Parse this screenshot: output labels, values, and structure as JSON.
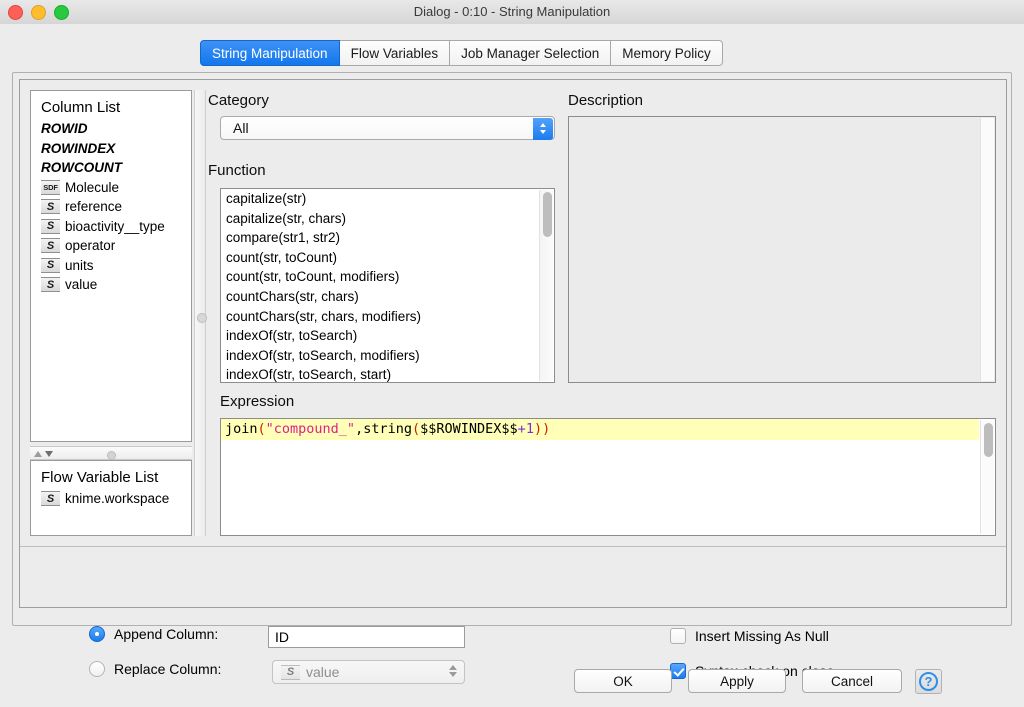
{
  "window": {
    "title": "Dialog - 0:10 - String Manipulation",
    "traffic_lights": [
      "close-button",
      "minimize-button",
      "maximize-button"
    ],
    "accent_blue": "#1a7cf0"
  },
  "tabs": [
    {
      "label": "String Manipulation",
      "active": true
    },
    {
      "label": "Flow Variables",
      "active": false
    },
    {
      "label": "Job Manager Selection",
      "active": false
    },
    {
      "label": "Memory Policy",
      "active": false
    }
  ],
  "column_list": {
    "title": "Column List",
    "items": [
      {
        "icon": "",
        "label": "ROWID",
        "type": "flowvar"
      },
      {
        "icon": "",
        "label": "ROWINDEX",
        "type": "flowvar"
      },
      {
        "icon": "",
        "label": "ROWCOUNT",
        "type": "flowvar"
      },
      {
        "icon": "SDF",
        "label": "Molecule",
        "type": "sdf"
      },
      {
        "icon": "S",
        "label": "reference",
        "type": "string"
      },
      {
        "icon": "S",
        "label": "bioactivity__type",
        "type": "string"
      },
      {
        "icon": "S",
        "label": "operator",
        "type": "string"
      },
      {
        "icon": "S",
        "label": "units",
        "type": "string"
      },
      {
        "icon": "S",
        "label": "value",
        "type": "string"
      }
    ]
  },
  "flow_variable_list": {
    "title": "Flow Variable List",
    "items": [
      {
        "icon": "S",
        "label": "knime.workspace"
      }
    ]
  },
  "category": {
    "label": "Category",
    "selected": "All"
  },
  "function": {
    "label": "Function",
    "items": [
      "capitalize(str)",
      "capitalize(str, chars)",
      "compare(str1, str2)",
      "count(str, toCount)",
      "count(str, toCount, modifiers)",
      "countChars(str, chars)",
      "countChars(str, chars, modifiers)",
      "indexOf(str, toSearch)",
      "indexOf(str, toSearch, modifiers)",
      "indexOf(str, toSearch, start)"
    ]
  },
  "description": {
    "label": "Description",
    "content": ""
  },
  "expression": {
    "label": "Expression",
    "tokens": [
      {
        "text": "join",
        "kind": "fn"
      },
      {
        "text": "(",
        "kind": "paren"
      },
      {
        "text": "\"compound_\"",
        "kind": "str"
      },
      {
        "text": ",",
        "kind": "fn"
      },
      {
        "text": "string",
        "kind": "fn"
      },
      {
        "text": "(",
        "kind": "paren"
      },
      {
        "text": "$$ROWINDEX$$",
        "kind": "fn"
      },
      {
        "text": "+",
        "kind": "op"
      },
      {
        "text": "1",
        "kind": "num"
      },
      {
        "text": ")",
        "kind": "paren"
      },
      {
        "text": ")",
        "kind": "paren"
      }
    ],
    "plain": "join(\"compound_\",string($$ROWINDEX$$+1))"
  },
  "options": {
    "append_column": {
      "label": "Append Column:",
      "selected": true,
      "value": "ID"
    },
    "replace_column": {
      "label": "Replace Column:",
      "selected": false,
      "value": "value",
      "icon": "S",
      "disabled": true
    },
    "insert_missing_as_null": {
      "label": "Insert Missing As Null",
      "checked": false
    },
    "syntax_check_on_close": {
      "label": "Syntax check on close",
      "checked": true
    }
  },
  "buttons": {
    "ok": "OK",
    "apply": "Apply",
    "cancel": "Cancel",
    "help": "?"
  }
}
